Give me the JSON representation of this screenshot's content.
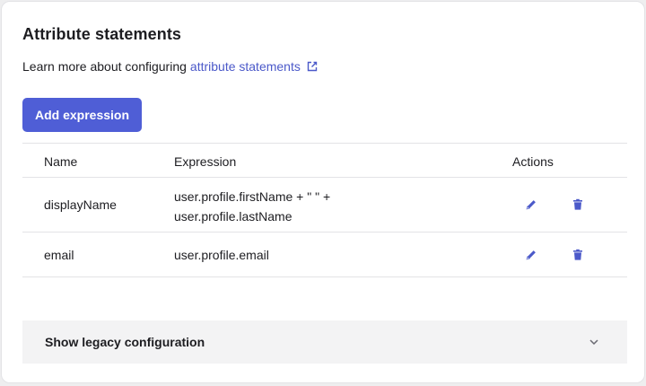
{
  "section": {
    "title": "Attribute statements",
    "learn_more_prefix": "Learn more about configuring",
    "learn_more_link": "attribute statements",
    "link_icon": "external-link-icon"
  },
  "add_button": {
    "label": "Add expression"
  },
  "table": {
    "columns": [
      "Name",
      "Expression",
      "Actions"
    ],
    "rows": [
      {
        "name": "displayName",
        "expression": "user.profile.firstName + \" \" + user.profile.lastName"
      },
      {
        "name": "email",
        "expression": "user.profile.email"
      }
    ],
    "action_icons": [
      "pencil-edit-icon",
      "trash-delete-icon"
    ]
  },
  "legacy": {
    "label": "Show legacy configuration",
    "icon": "chevron-down-icon"
  },
  "colors": {
    "primary": "#4f5ed6",
    "link": "#4b59c9",
    "icon": "#4b59c9"
  }
}
